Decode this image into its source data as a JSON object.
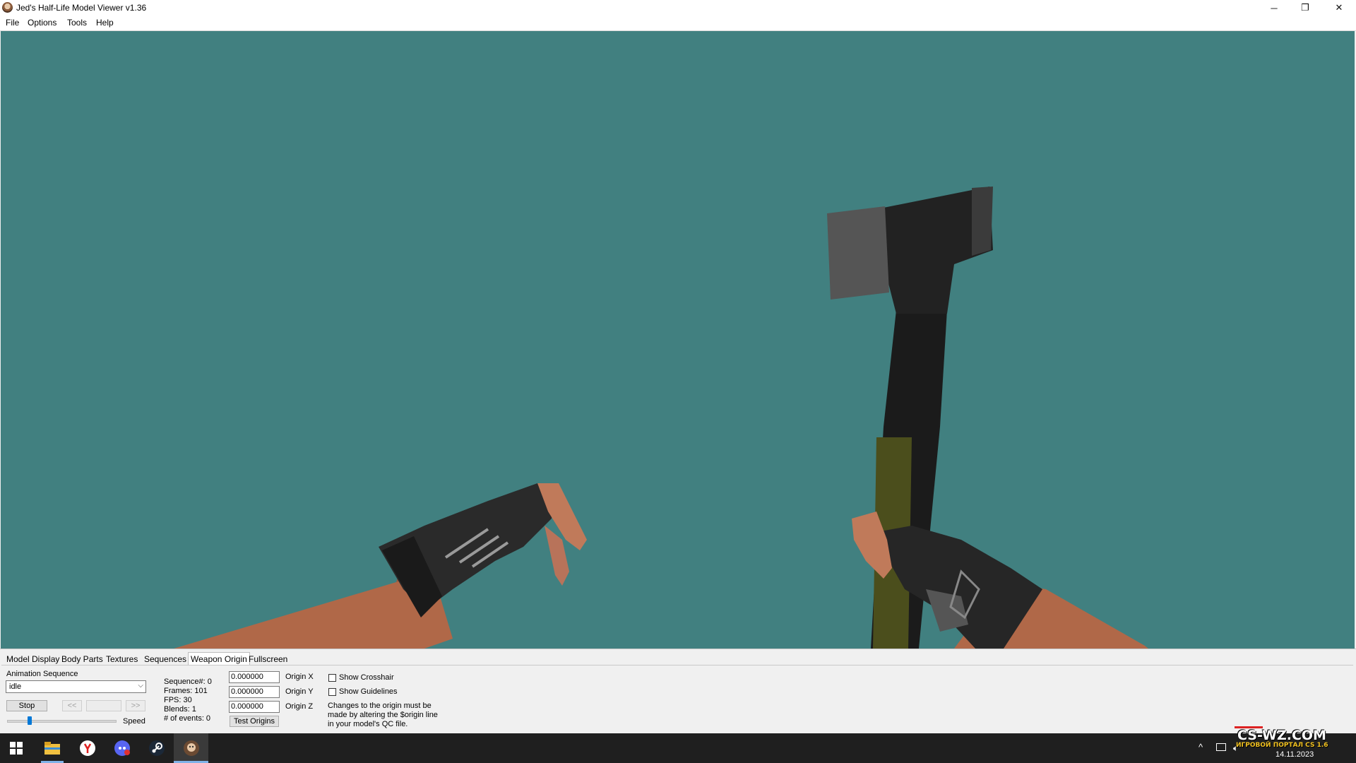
{
  "window": {
    "title": "Jed's Half-Life Model Viewer v1.36",
    "controls": {
      "minimize": "─",
      "maximize": "❐",
      "close": "✕"
    }
  },
  "menu": [
    "File",
    "Options",
    "Tools",
    "Help"
  ],
  "viewport": {
    "background": "#418080"
  },
  "tabs": [
    {
      "label": "Model Display",
      "active": false
    },
    {
      "label": "Body Parts",
      "active": false
    },
    {
      "label": "Textures",
      "active": false
    },
    {
      "label": "Sequences",
      "active": false
    },
    {
      "label": "Weapon Origin",
      "active": true
    },
    {
      "label": "Fullscreen",
      "active": false
    }
  ],
  "panel": {
    "animation_label": "Animation Sequence",
    "sequence_selected": "idle",
    "stop_label": "Stop",
    "prev_label": "<<",
    "next_label": ">>",
    "speed_label": "Speed",
    "speed_value": 0.2,
    "info": {
      "sequence": "Sequence#: 0",
      "frames": "Frames: 101",
      "fps": "FPS: 30",
      "blends": "Blends: 1",
      "events": "# of events: 0"
    },
    "origin": [
      {
        "value": "0.000000",
        "label": "Origin X"
      },
      {
        "value": "0.000000",
        "label": "Origin Y"
      },
      {
        "value": "0.000000",
        "label": "Origin Z"
      }
    ],
    "test_origins_label": "Test Origins",
    "show_crosshair_label": "Show Crosshair",
    "show_crosshair_checked": false,
    "show_guidelines_label": "Show Guidelines",
    "show_guidelines_checked": false,
    "note_line1": "Changes to the origin must be",
    "note_line2": "made by altering the $origin line",
    "note_line3": "in your model's QC file."
  },
  "taskbar": {
    "icons": [
      "windows-start-icon",
      "file-explorer-icon",
      "yandex-browser-icon",
      "discord-icon",
      "steam-icon",
      "model-viewer-icon"
    ],
    "date": "14.11.2023",
    "tray_up": "^"
  },
  "watermark": {
    "logo": "CS-WZ.COM",
    "tagline": "ИГРОВОЙ ПОРТАЛ CS 1.6"
  }
}
